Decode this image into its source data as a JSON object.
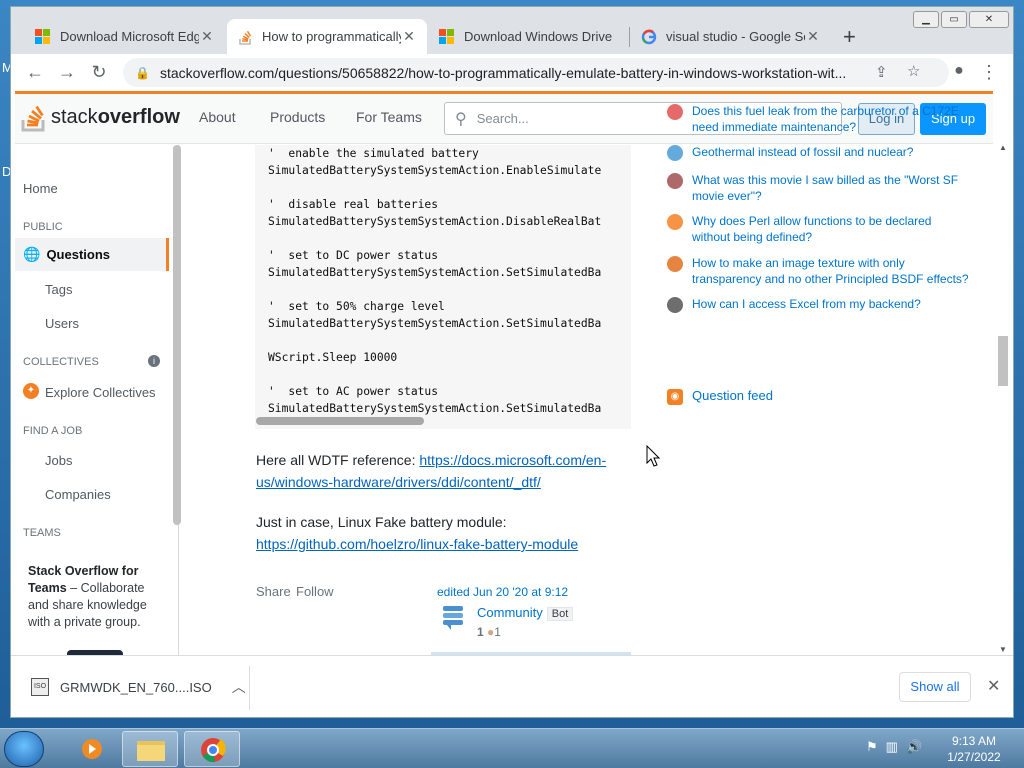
{
  "browser": {
    "tabs": [
      {
        "title": "Download Microsoft Edge",
        "icon": "microsoft-logo-icon"
      },
      {
        "title": "How to programmatically",
        "icon": "stackoverflow-icon"
      },
      {
        "title": "Download Windows Drive",
        "icon": "microsoft-logo-icon"
      },
      {
        "title": "visual studio - Google Se",
        "icon": "google-icon"
      }
    ],
    "url": "stackoverflow.com/questions/50658822/how-to-programmatically-emulate-battery-in-windows-workstation-wit..."
  },
  "header": {
    "logo_text_a": "stack",
    "logo_text_b": "overflow",
    "nav": [
      "About",
      "Products",
      "For Teams"
    ],
    "search_placeholder": "Search...",
    "login": "Log in",
    "signup": "Sign up"
  },
  "leftnav": {
    "home": "Home",
    "public": "PUBLIC",
    "questions": "Questions",
    "tags": "Tags",
    "users": "Users",
    "collectives": "COLLECTIVES",
    "explore": "Explore Collectives",
    "find_job": "FIND A JOB",
    "jobs": "Jobs",
    "companies": "Companies",
    "teams": "TEAMS",
    "teams_title": "Stack Overflow for Teams",
    "teams_desc": " – Collaborate and share knowledge with a private group."
  },
  "code_lines": [
    "'  enable the simulated battery",
    "SimulatedBatterySystemSystemAction.EnableSimulate",
    "",
    "'  disable real batteries",
    "SimulatedBatterySystemSystemAction.DisableRealBat",
    "",
    "'  set to DC power status",
    "SimulatedBatterySystemSystemAction.SetSimulatedBa",
    "",
    "'  set to 50% charge level",
    "SimulatedBatterySystemSystemAction.SetSimulatedBa",
    "",
    "WScript.Sleep 10000",
    "",
    "'  set to AC power status",
    "SimulatedBatterySystemSystemAction.SetSimulatedBa"
  ],
  "answer": {
    "p1_text": "Here all WDTF reference: ",
    "p1_link_a": "https://docs.microsoft.com/en-",
    "p1_link_b": "us/windows-hardware/drivers/ddi/content/_dtf/",
    "p2_text": "Just in case, Linux Fake battery module:",
    "p2_link": "https://github.com/hoelzro/linux-fake-battery-module",
    "share": "Share",
    "follow": "Follow",
    "edited": "edited Jun 20 '20 at 9:12",
    "user": "Community",
    "bot": "Bot",
    "rep": "1",
    "bronze": "1"
  },
  "hot_questions": [
    {
      "text": "Does this fuel leak from the carburetor of a C172E need immediate maintenance?",
      "icon": "aviation-icon",
      "color": "#e05050"
    },
    {
      "text": "Geothermal instead of fossil and nuclear?",
      "icon": "earth-science-icon",
      "color": "#4a9bd6"
    },
    {
      "text": "What was this movie I saw billed as the \"Worst SF movie ever\"?",
      "icon": "scifi-icon",
      "color": "#a05050"
    },
    {
      "text": "Why does Perl allow functions to be declared without being defined?",
      "icon": "stackoverflow-icon",
      "color": "#f48024"
    },
    {
      "text": "How to make an image texture with only transparency and no other Principled BSDF effects?",
      "icon": "blender-icon",
      "color": "#e07020"
    },
    {
      "text": "How can I access Excel from my backend?",
      "icon": "software-recs-icon",
      "color": "#555555"
    }
  ],
  "question_feed": "Question feed",
  "download": {
    "file": "GRMWDK_EN_760....ISO",
    "show_all": "Show all"
  },
  "taskbar": {
    "time": "9:13 AM",
    "date": "1/27/2022"
  }
}
